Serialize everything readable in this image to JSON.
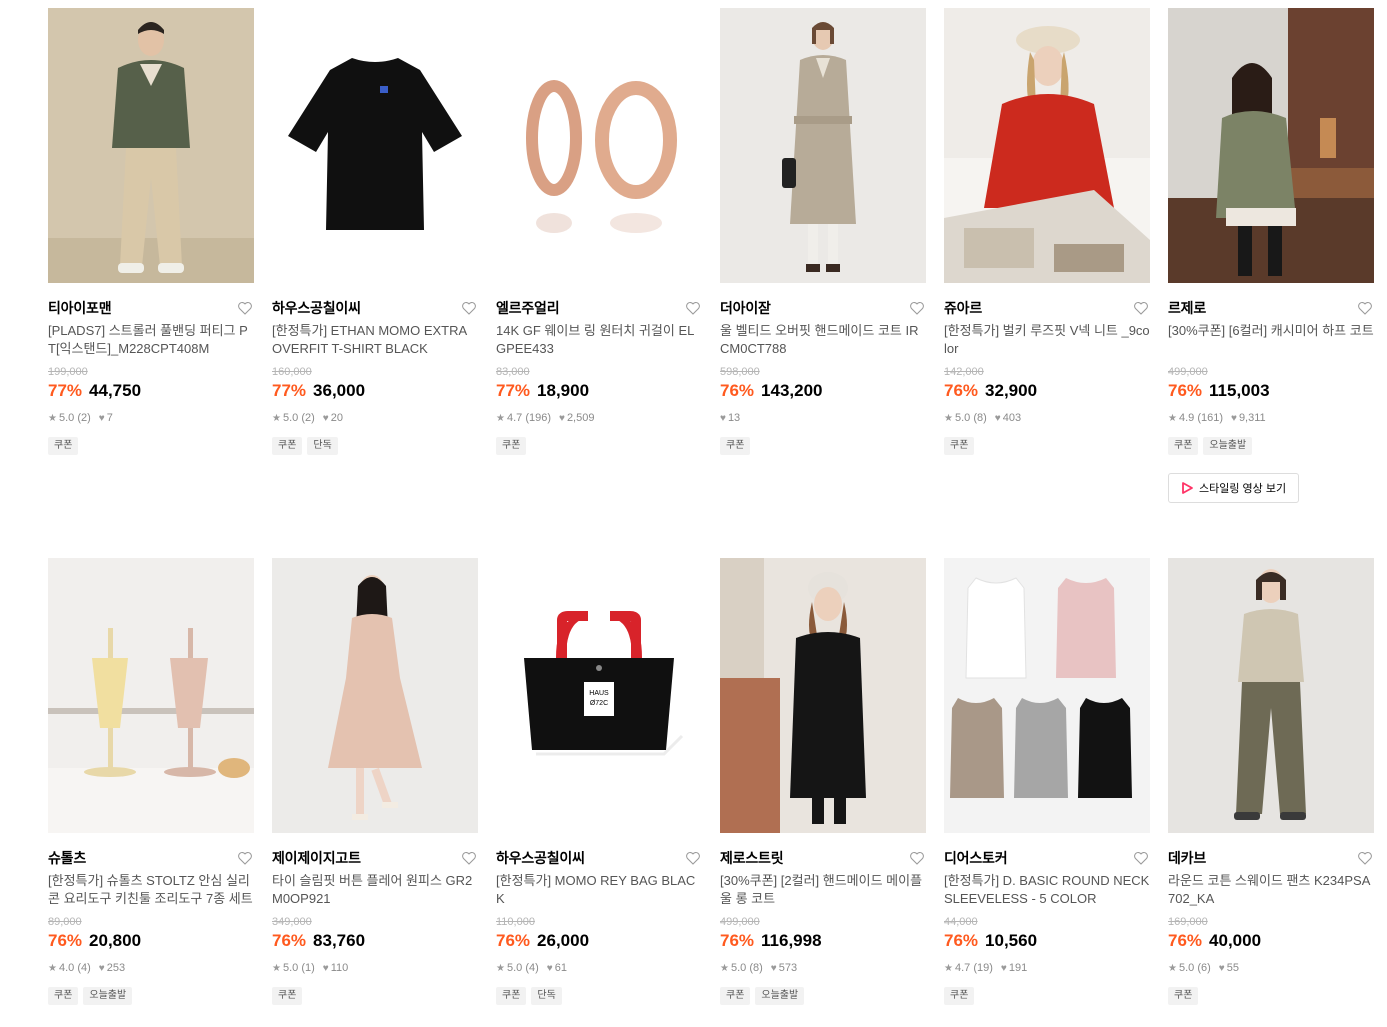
{
  "products_row1": [
    {
      "brand": "티아이포맨",
      "name": "[PLADS7] 스트롤러 풀밴딩 퍼티그 PT[익스탠드]_M228CPT408M",
      "original_price": "199,000",
      "discount": "77%",
      "price": "44,750",
      "rating": "5.0 (2)",
      "likes": "7",
      "tags": [
        "쿠폰"
      ],
      "image": "model-khaki-jacket"
    },
    {
      "brand": "하우스공칠이씨",
      "name": "[한정특가] ETHAN MOMO EXTRA OVERFIT T-SHIRT BLACK",
      "original_price": "160,000",
      "discount": "77%",
      "price": "36,000",
      "rating": "5.0 (2)",
      "likes": "20",
      "tags": [
        "쿠폰",
        "단독"
      ],
      "image": "black-tshirt"
    },
    {
      "brand": "엘르주얼리",
      "name": "14K GF 웨이브 링 원터치 귀걸이 ELGPEE433",
      "original_price": "83,000",
      "discount": "77%",
      "price": "18,900",
      "rating": "4.7 (196)",
      "likes": "2,509",
      "tags": [
        "쿠폰"
      ],
      "image": "rose-gold-earrings"
    },
    {
      "brand": "더아이잗",
      "name": "울 벨티드 오버핏 핸드메이드 코트 IRCM0CT788",
      "original_price": "598,000",
      "discount": "76%",
      "price": "143,200",
      "rating": "",
      "likes": "13",
      "tags": [
        "쿠폰"
      ],
      "image": "model-beige-coat"
    },
    {
      "brand": "쥬아르",
      "name": "[한정특가] 벌키 루즈핏 V넥 니트 _9color",
      "original_price": "142,000",
      "discount": "76%",
      "price": "32,900",
      "rating": "5.0 (8)",
      "likes": "403",
      "tags": [
        "쿠폰"
      ],
      "image": "model-red-knit"
    },
    {
      "brand": "르제로",
      "name": "[30%쿠폰] [6컬러] 캐시미어 하프 코트",
      "original_price": "499,000",
      "discount": "76%",
      "price": "115,003",
      "rating": "4.9 (161)",
      "likes": "9,311",
      "tags": [
        "쿠폰",
        "오늘출발"
      ],
      "image": "model-olive-coat",
      "video_label": "스타일링 영상 보기"
    }
  ],
  "products_row2": [
    {
      "brand": "슈톨츠",
      "name": "[한정특가] 슈톨츠 STOLTZ 안심 실리콘 요리도구 키친툴 조리도구 7종 세트",
      "original_price": "89,000",
      "discount": "76%",
      "price": "20,800",
      "rating": "4.0 (4)",
      "likes": "253",
      "tags": [
        "쿠폰",
        "오늘출발"
      ],
      "image": "kitchen-tools"
    },
    {
      "brand": "제이제이지고트",
      "name": "타이 슬림핏 버튼 플레어 원피스 GR2M0OP921",
      "original_price": "349,000",
      "discount": "76%",
      "price": "83,760",
      "rating": "5.0 (1)",
      "likes": "110",
      "tags": [
        "쿠폰"
      ],
      "image": "model-pink-dress"
    },
    {
      "brand": "하우스공칠이씨",
      "name": "[한정특가] MOMO REY BAG BLACK",
      "original_price": "110,000",
      "discount": "76%",
      "price": "26,000",
      "rating": "5.0 (4)",
      "likes": "61",
      "tags": [
        "쿠폰",
        "단독"
      ],
      "image": "black-red-tote",
      "label_lines": [
        "HAUS",
        "Ø72C"
      ]
    },
    {
      "brand": "제로스트릿",
      "name": "[30%쿠폰] [2컬러] 핸드메이드 메이플 울 롱 코트",
      "original_price": "499,000",
      "discount": "76%",
      "price": "116,998",
      "rating": "5.0 (8)",
      "likes": "573",
      "tags": [
        "쿠폰",
        "오늘출발"
      ],
      "image": "model-black-coat"
    },
    {
      "brand": "디어스토커",
      "name": "[한정특가] D. BASIC ROUND NECK SLEEVELESS - 5 COLOR",
      "original_price": "44,000",
      "discount": "76%",
      "price": "10,560",
      "rating": "4.7 (19)",
      "likes": "191",
      "tags": [
        "쿠폰"
      ],
      "image": "sleeveless-set"
    },
    {
      "brand": "데카브",
      "name": "라운드 코튼 스웨이드 팬츠 K234PSA702_KA",
      "original_price": "169,000",
      "discount": "76%",
      "price": "40,000",
      "rating": "5.0 (6)",
      "likes": "55",
      "tags": [
        "쿠폰"
      ],
      "image": "model-khaki-pants"
    }
  ],
  "icons": {
    "heart": "heart-outline-icon",
    "star": "star-icon",
    "like": "heart-filled-icon",
    "play": "play-icon"
  },
  "colors": {
    "discount": "#ff5a1f",
    "price": "#000000",
    "muted": "#8a8a8a",
    "tag_bg": "#f2f2f2",
    "play": "#ff3366"
  }
}
